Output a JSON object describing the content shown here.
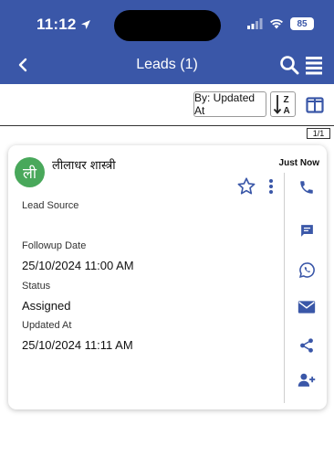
{
  "status_bar": {
    "time": "11:12",
    "battery": "85"
  },
  "nav": {
    "title": "Leads (1)"
  },
  "toolbar": {
    "sort_label": "By: Updated At"
  },
  "page_count": "1/1",
  "lead": {
    "avatar_initial": "ली",
    "name": "लीलाधर शास्त्री",
    "updated_relative": "Just Now",
    "fields": {
      "lead_source_label": "Lead Source",
      "followup_label": "Followup Date",
      "followup_value": "25/10/2024 11:00 AM",
      "status_label": "Status",
      "status_value": "Assigned",
      "updated_label": "Updated At",
      "updated_value": "25/10/2024 11:11 AM"
    }
  },
  "colors": {
    "primary": "#3a57a8",
    "avatar": "#49a85b"
  },
  "icons": [
    "location-arrow-icon",
    "signal-icon",
    "wifi-icon",
    "battery-icon",
    "back-icon",
    "search-icon",
    "menu-icon",
    "sort-az-icon",
    "columns-icon",
    "star-icon",
    "more-vertical-icon",
    "phone-icon",
    "message-icon",
    "whatsapp-icon",
    "email-icon",
    "share-icon",
    "add-user-icon"
  ]
}
